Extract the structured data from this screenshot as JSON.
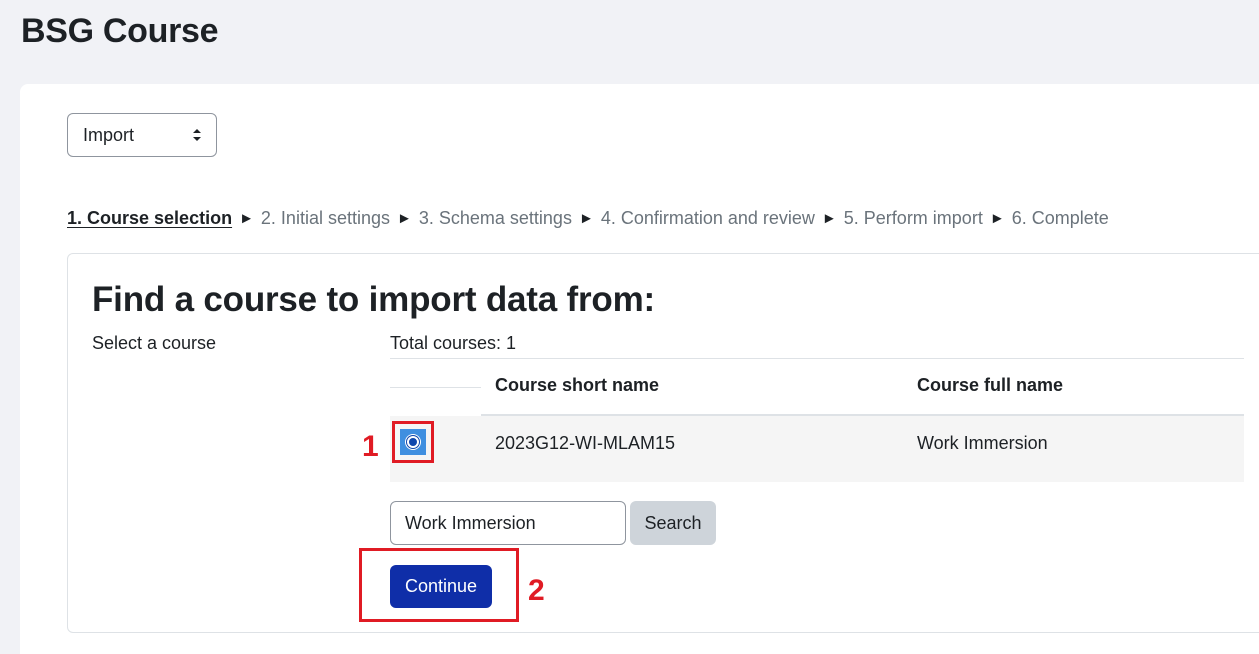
{
  "page": {
    "title": "BSG Course"
  },
  "action_select": {
    "value": "Import"
  },
  "steps": {
    "current": "1. Course selection",
    "separator": "►",
    "others": [
      "2. Initial settings",
      "3. Schema settings",
      "4. Confirmation and review",
      "5. Perform import",
      "6. Complete"
    ]
  },
  "find": {
    "heading": "Find a course to import data from:",
    "label": "Select a course",
    "total": "Total courses: 1"
  },
  "table": {
    "columns": [
      "Course short name",
      "Course full name"
    ],
    "rows": [
      {
        "short_name": "2023G12-WI-MLAM15",
        "full_name": "Work Immersion",
        "selected": true
      }
    ]
  },
  "search": {
    "value": "Work Immersion",
    "button_label": "Search"
  },
  "continue_label": "Continue",
  "annotations": {
    "marker_1": "1",
    "marker_2": "2",
    "color": "#e01b24"
  },
  "colors": {
    "primary": "#0f2ea8",
    "radio": "#3f8fe0",
    "background": "#f1f2f6"
  }
}
